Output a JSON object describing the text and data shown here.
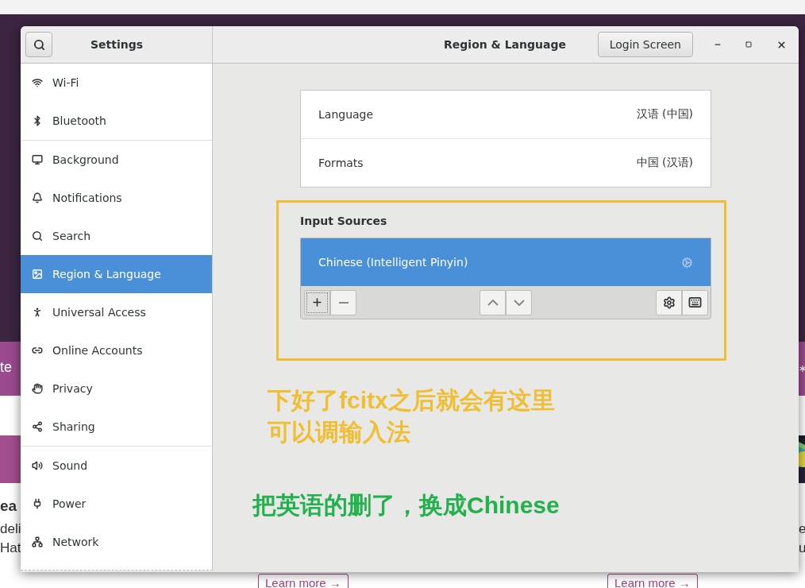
{
  "window": {
    "sidebar_title": "Settings",
    "title": "Region & Language",
    "header_button": "Login Screen"
  },
  "sidebar": {
    "groups": [
      [
        {
          "label": "Wi-Fi",
          "selected": false
        },
        {
          "label": "Bluetooth",
          "selected": false
        }
      ],
      [
        {
          "label": "Background",
          "selected": false
        },
        {
          "label": "Notifications",
          "selected": false
        },
        {
          "label": "Search",
          "selected": false
        },
        {
          "label": "Region & Language",
          "selected": true
        },
        {
          "label": "Universal Access",
          "selected": false
        },
        {
          "label": "Online Accounts",
          "selected": false
        },
        {
          "label": "Privacy",
          "selected": false
        },
        {
          "label": "Sharing",
          "selected": false
        }
      ],
      [
        {
          "label": "Sound",
          "selected": false
        },
        {
          "label": "Power",
          "selected": false
        },
        {
          "label": "Network",
          "selected": false
        }
      ]
    ]
  },
  "language_settings": [
    {
      "label": "Language",
      "value": "汉语 (中国)"
    },
    {
      "label": "Formats",
      "value": "中国 (汉语)"
    }
  ],
  "input_sources": {
    "heading": "Input Sources",
    "items": [
      {
        "label": "Chinese (Intelligent Pinyin)",
        "selected": true
      }
    ]
  },
  "annotations": [
    {
      "color": "#f0be32",
      "lines": [
        "下好了fcitx之后就会有这里",
        "可以调输入法"
      ]
    },
    {
      "color": "#22b14c",
      "lines": [
        "把英语的删了，换成Chinese"
      ]
    }
  ],
  "background_page": {
    "banner_text": "te",
    "heading": "ea",
    "lines": [
      "deli",
      "Hat"
    ],
    "right_lines": [
      "e",
      "u"
    ],
    "links": [
      "Learn more →",
      "Learn more →"
    ]
  }
}
